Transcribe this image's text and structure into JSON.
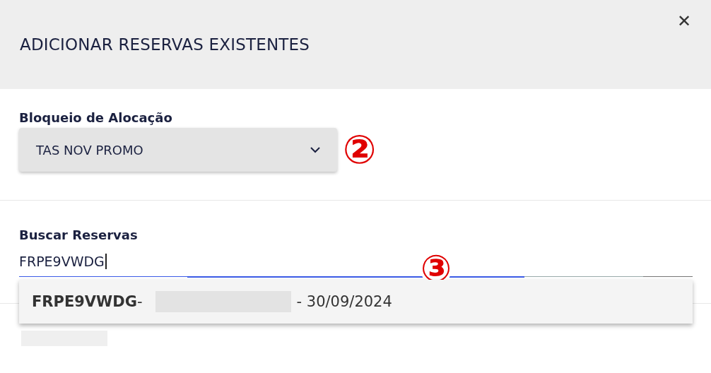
{
  "dialog": {
    "title": "ADICIONAR RESERVAS EXISTENTES",
    "close": "✕"
  },
  "allocation": {
    "label": "Bloqueio de Alocação",
    "value": "TAS NOV PROMO",
    "marker": "②"
  },
  "search": {
    "label": "Buscar Reservas",
    "value": "FRPE9VWDG",
    "marker": "③",
    "suggestions": [
      {
        "code": "FRPE9VWDG",
        "separator": "-",
        "date": "- 30/09/2024"
      }
    ]
  }
}
